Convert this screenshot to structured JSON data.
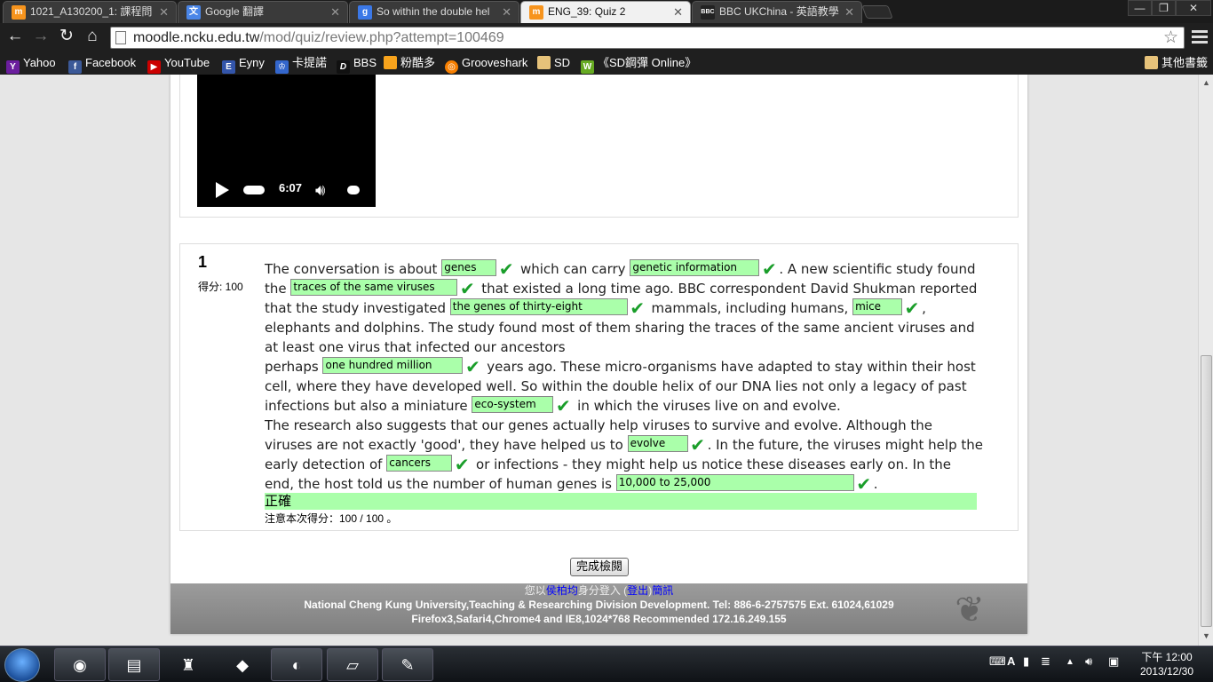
{
  "browser": {
    "tabs": [
      {
        "title": "1021_A130200_1: 課程問",
        "icon": "moodle-icon",
        "active": false
      },
      {
        "title": "Google 翻譯",
        "icon": "google-translate-icon",
        "active": false
      },
      {
        "title": "So within the double hel",
        "icon": "google-search-icon",
        "active": false
      },
      {
        "title": "ENG_39: Quiz 2",
        "icon": "moodle-icon",
        "active": true
      },
      {
        "title": "BBC UKChina - 英語教學",
        "icon": "bbc-icon",
        "active": false
      }
    ],
    "url_host": "moodle.ncku.edu.tw",
    "url_path": "/mod/quiz/review.php?attempt=100469",
    "bookmarks": [
      {
        "label": "Yahoo",
        "icon": "yahoo-icon",
        "color": "#6b1e9e"
      },
      {
        "label": "Facebook",
        "icon": "facebook-icon",
        "color": "#3b5998"
      },
      {
        "label": "YouTube",
        "icon": "youtube-icon",
        "color": "#cc0000"
      },
      {
        "label": "Eyny",
        "icon": "eyny-icon",
        "color": "#3355aa"
      },
      {
        "label": "卡提諾",
        "icon": "ck101-icon",
        "color": "#3366cc"
      },
      {
        "label": "BBS",
        "icon": "bbs-icon",
        "color": "#111111"
      },
      {
        "label": "粉酷多",
        "icon": "folder-icon",
        "color": "#f7a31c"
      },
      {
        "label": "Grooveshark",
        "icon": "grooveshark-icon",
        "color": "#f77f00"
      },
      {
        "label": "SD",
        "icon": "folder-icon",
        "color": "#e6c27a"
      },
      {
        "label": "《SD鋼彈 Online》",
        "icon": "sd-gundam-icon",
        "color": "#66aa22"
      }
    ],
    "other_bookmarks": "其他書籤"
  },
  "media": {
    "time": "6:07"
  },
  "question": {
    "number": "1",
    "grade": "得分: 100",
    "text": {
      "s1": "The conversation is about",
      "s2": "which can carry",
      "s3": ". A new scientific study found the",
      "s4": "that existed a long time ago. BBC correspondent David Shukman reported that the study investigated",
      "s5": "mammals, including humans,",
      "s6": ", elephants and dolphins. The study found most of them sharing the traces of the same ancient viruses and at least one virus that infected our ancestors",
      "s7": "perhaps",
      "s8": "years ago. These micro-organisms have adapted to stay within their host cell, where they have developed well. So within the double helix of our DNA lies not only a legacy of past infections but also a miniature",
      "s9": "in which the viruses live on and evolve.",
      "s10": "The research also suggests that our genes actually help viruses to survive and evolve. Although the viruses are not exactly 'good', they have helped us to",
      "s11": ". In the future, the viruses might help the early detection of",
      "s12": "or infections - they might help us notice these diseases early on. In the end, the host told us the number of human genes is",
      "s13": "."
    },
    "answers": {
      "a1": "genes",
      "a2": "genetic information",
      "a3": "traces of the same viruses",
      "a4": "the genes of thirty-eight",
      "a5": "mice",
      "a6": "one hundred million",
      "a7": "eco-system",
      "a8": "evolve",
      "a9": "cancers",
      "a10": "10,000 to 25,000"
    },
    "feedback": "正確",
    "score_note": "注意本次得分：100 / 100 。",
    "correct_color": "#aaffaa",
    "check_color": "#1a9e2a"
  },
  "finish_review_label": "完成檢閱",
  "footer": {
    "login_prefix": "您以",
    "user_name": "侯柏均",
    "login_middle": "身分登入 (",
    "logout": "登出",
    "login_suffix": ")",
    "messages": "簡訊",
    "line1": "National Cheng Kung University,Teaching & Researching Division Development. Tel: 886-6-2757575 Ext. 61024,61029",
    "line2": "Firefox3,Safari4,Chrome4 and IE8,1024*768 Recommended 172.16.249.155"
  },
  "taskbar": {
    "clock_time": "下午 12:00",
    "clock_date": "2013/12/30"
  }
}
